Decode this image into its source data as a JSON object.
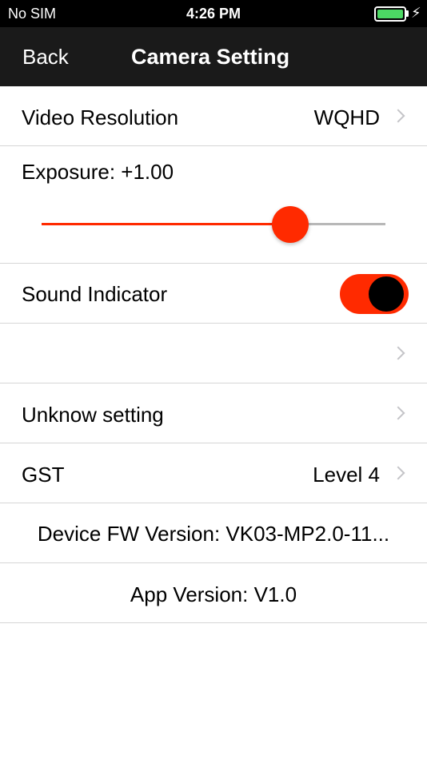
{
  "status_bar": {
    "carrier": "No SIM",
    "time": "4:26 PM",
    "battery_level": 1.0,
    "battery_color": "#4cd964",
    "charging_icon": "bolt-icon"
  },
  "nav": {
    "back_label": "Back",
    "title": "Camera Setting"
  },
  "settings": {
    "video_resolution": {
      "label": "Video Resolution",
      "value": "WQHD"
    },
    "exposure": {
      "label": "Exposure: +1.00",
      "slider_level": 0.72
    },
    "sound_indicator": {
      "label": "Sound Indicator",
      "enabled": true
    },
    "blank_row": {
      "label": ""
    },
    "unknow_setting": {
      "label": "Unknow setting"
    },
    "gst": {
      "label": "GST",
      "value": "Level 4"
    },
    "device_fw": {
      "text": "Device FW Version: VK03-MP2.0-11..."
    },
    "app_version": {
      "text": "App Version: V1.0"
    }
  },
  "colors": {
    "accent": "#ff2a00",
    "nav_background": "#1a1a1a",
    "separator": "#d6d6d6",
    "chevron": "#c4c4c8"
  }
}
